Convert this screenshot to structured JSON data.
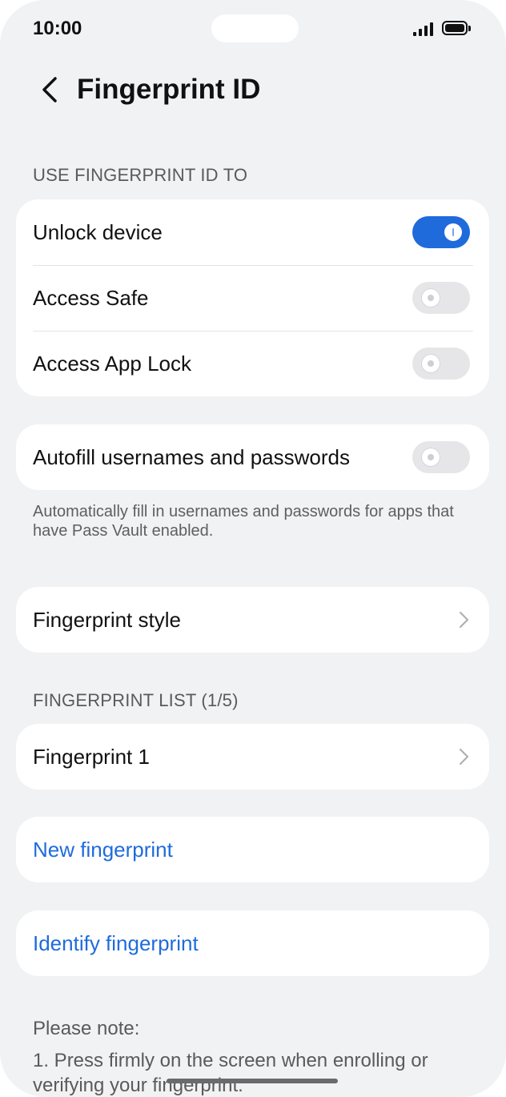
{
  "status_bar": {
    "time": "10:00"
  },
  "header": {
    "title": "Fingerprint ID"
  },
  "use_section": {
    "label": "USE FINGERPRINT ID TO",
    "items": [
      {
        "label": "Unlock device",
        "enabled": true
      },
      {
        "label": "Access Safe",
        "enabled": false
      },
      {
        "label": "Access App Lock",
        "enabled": false
      }
    ]
  },
  "autofill": {
    "label": "Autofill usernames and passwords",
    "enabled": false,
    "description": "Automatically fill in usernames and passwords for apps that have Pass Vault enabled."
  },
  "style_item": {
    "label": "Fingerprint style"
  },
  "list_section": {
    "label": "FINGERPRINT LIST (1/5)",
    "items": [
      {
        "label": "Fingerprint 1"
      }
    ]
  },
  "actions": {
    "new_fingerprint": "New fingerprint",
    "identify_fingerprint": "Identify fingerprint"
  },
  "note": {
    "title": "Please note:",
    "text": "1. Press firmly on the screen when enrolling or verifying your fingerprint."
  },
  "colors": {
    "accent": "#1f6bdc",
    "background": "#f1f2f4",
    "card": "#ffffff"
  }
}
